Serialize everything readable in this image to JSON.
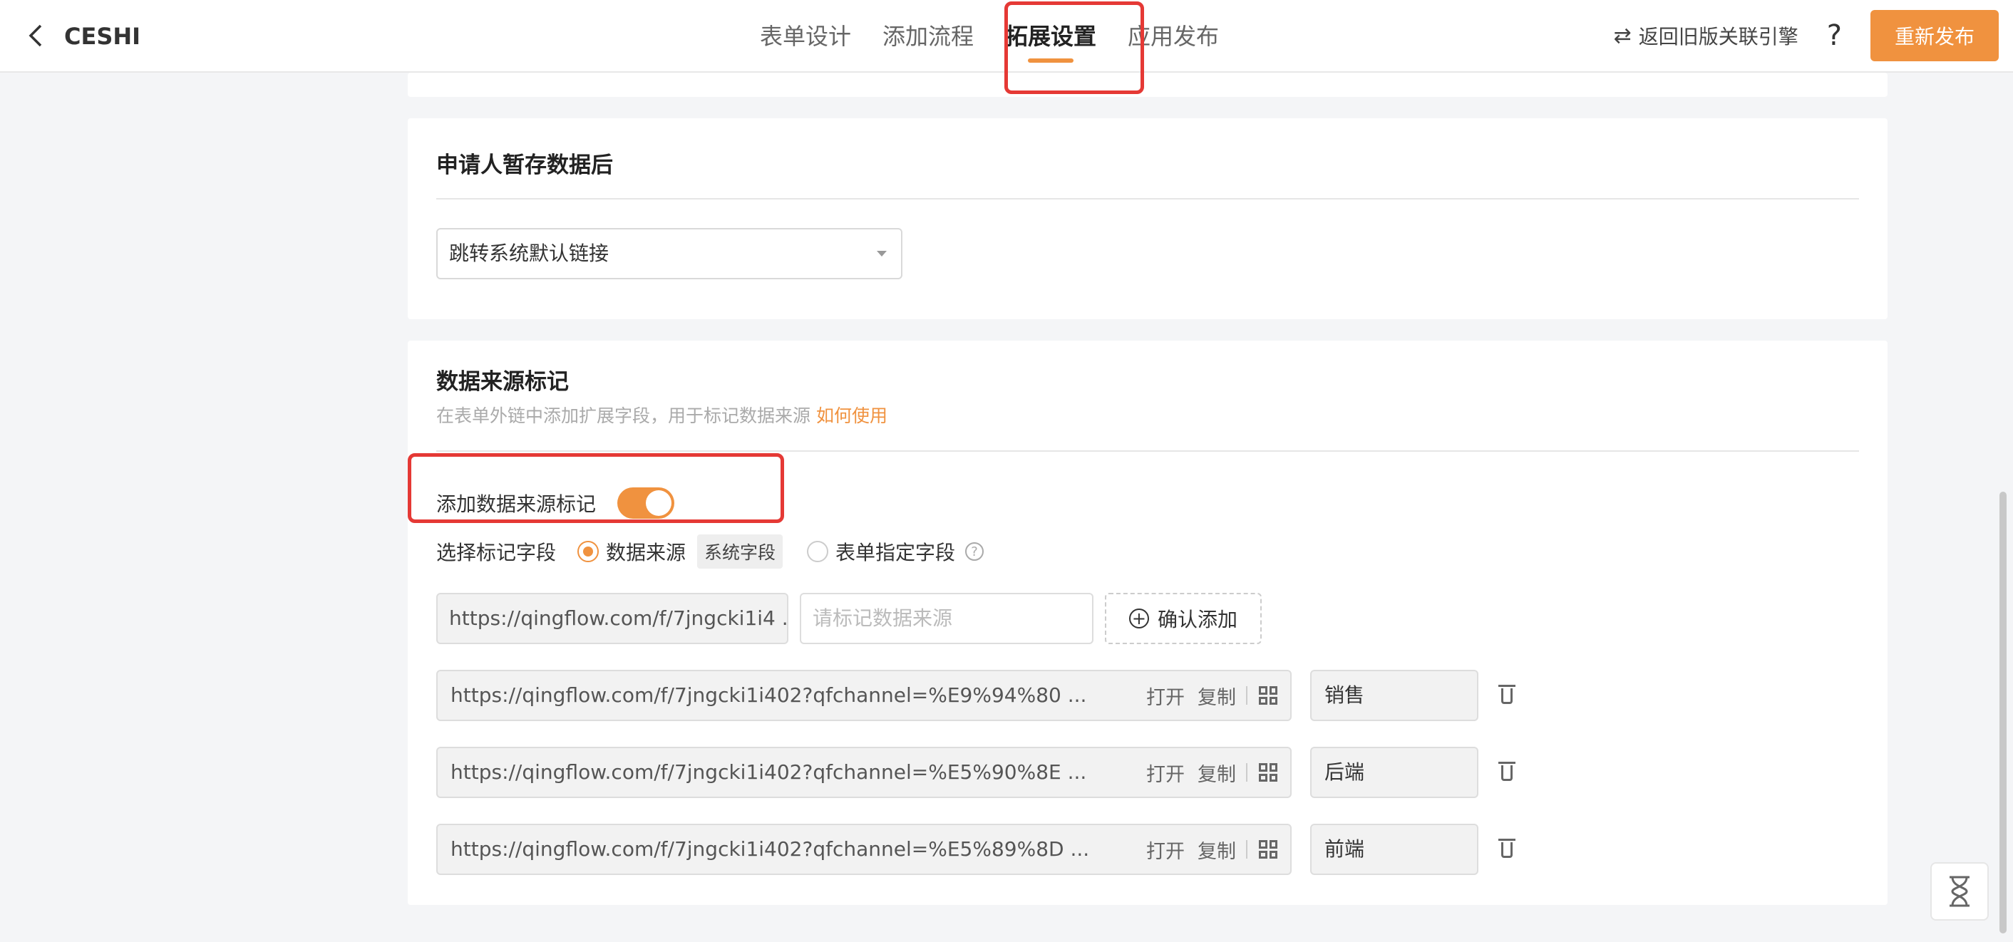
{
  "header": {
    "app_title": "CESHI",
    "tabs": [
      {
        "label": "表单设计"
      },
      {
        "label": "添加流程"
      },
      {
        "label": "拓展设置"
      },
      {
        "label": "应用发布"
      }
    ],
    "active_tab": "拓展设置",
    "legacy_link": "返回旧版关联引擎",
    "help": "?",
    "publish_label": "重新发布"
  },
  "after_save": {
    "title": "申请人暂存数据后",
    "select_value": "跳转系统默认链接"
  },
  "source_mark": {
    "title": "数据来源标记",
    "description": "在表单外链中添加扩展字段，用于标记数据来源",
    "how_to_link": "如何使用",
    "toggle_label": "添加数据来源标记",
    "toggle_on": true,
    "field_label": "选择标记字段",
    "option_source": "数据来源",
    "system_tag": "系统字段",
    "option_form_field": "表单指定字段",
    "url_value": "https://qingflow.com/f/7jngcki1i4 ...",
    "tag_placeholder": "请标记数据来源",
    "confirm_label": "确认添加",
    "rows": [
      {
        "url": "https://qingflow.com/f/7jngcki1i402?qfchannel=%E9%94%80  ...",
        "label": "销售"
      },
      {
        "url": "https://qingflow.com/f/7jngcki1i402?qfchannel=%E5%90%8E  ...",
        "label": "后端"
      },
      {
        "url": "https://qingflow.com/f/7jngcki1i402?qfchannel=%E5%89%8D  ...",
        "label": "前端"
      }
    ],
    "open_label": "打开",
    "copy_label": "复制"
  }
}
